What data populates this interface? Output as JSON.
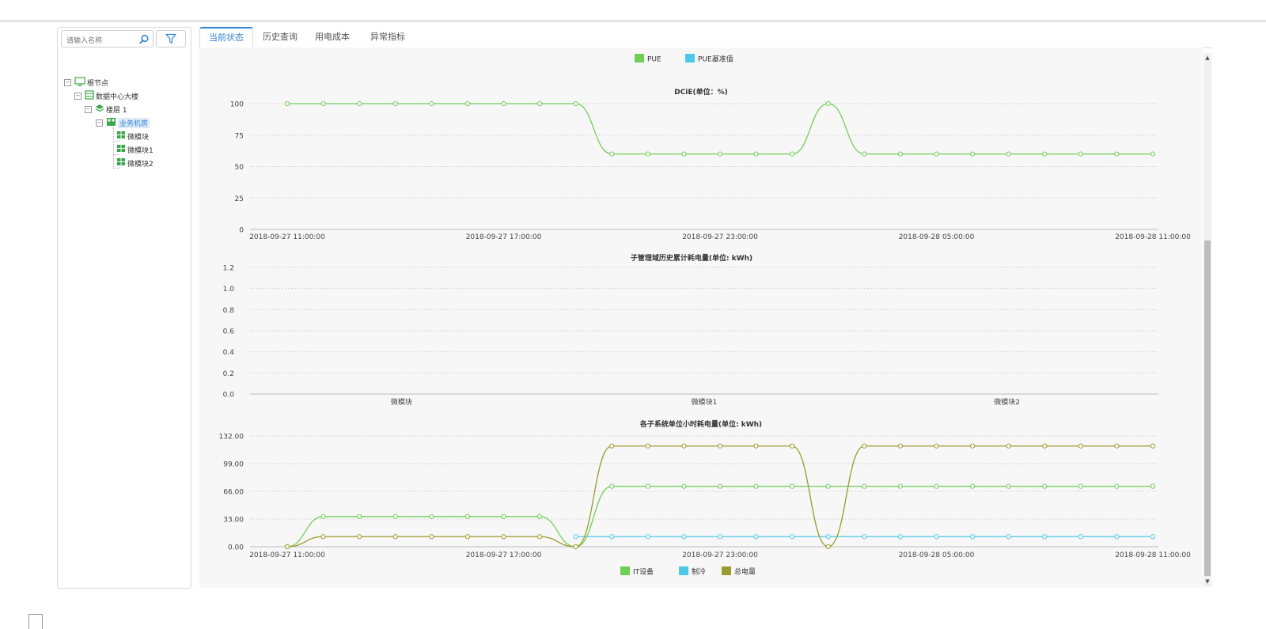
{
  "search": {
    "placeholder": "请输入名称"
  },
  "icons": {
    "search": "search-icon",
    "filter": "filter-icon"
  },
  "tree": {
    "root": "根节点",
    "building": "数据中心大楼",
    "floor": "楼层 1",
    "room": "业务机房",
    "modules": [
      "微模块",
      "微模块1",
      "微模块2"
    ]
  },
  "tabs": [
    "当前状态",
    "历史查询",
    "用电成本",
    "异常指标"
  ],
  "colors": {
    "accent": "#2e87d4",
    "green": "#6fcf57",
    "cyan": "#4dc8ea",
    "olive": "#9a9a2e"
  },
  "chart_data": [
    {
      "type": "line",
      "title": "DCiE(单位：%)",
      "legend": [
        "PUE",
        "PUE基准值"
      ],
      "legend_placement": "top-center",
      "ylim": [
        0,
        100
      ],
      "yticks": [
        "0",
        "25",
        "50",
        "75",
        "100"
      ],
      "x": [
        "2018-09-27 11:00:00",
        "2018-09-27 12:00:00",
        "2018-09-27 13:00:00",
        "2018-09-27 14:00:00",
        "2018-09-27 15:00:00",
        "2018-09-27 16:00:00",
        "2018-09-27 17:00:00",
        "2018-09-27 18:00:00",
        "2018-09-27 19:00:00",
        "2018-09-27 20:00:00",
        "2018-09-27 21:00:00",
        "2018-09-27 22:00:00",
        "2018-09-27 23:00:00",
        "2018-09-28 00:00:00",
        "2018-09-28 01:00:00",
        "2018-09-28 02:00:00",
        "2018-09-28 03:00:00",
        "2018-09-28 04:00:00",
        "2018-09-28 05:00:00",
        "2018-09-28 06:00:00",
        "2018-09-28 07:00:00",
        "2018-09-28 08:00:00",
        "2018-09-28 09:00:00",
        "2018-09-28 10:00:00",
        "2018-09-28 11:00:00"
      ],
      "xticks": [
        "2018-09-27 11:00:00",
        "2018-09-27 17:00:00",
        "2018-09-27 23:00:00",
        "2018-09-28 05:00:00",
        "2018-09-28 11:00:00"
      ],
      "series": [
        {
          "name": "PUE",
          "color": "#6fcf57",
          "values": [
            100,
            100,
            100,
            100,
            100,
            100,
            100,
            100,
            100,
            60,
            60,
            60,
            60,
            60,
            60,
            100,
            60,
            60,
            60,
            60,
            60,
            60,
            60,
            60,
            60
          ]
        }
      ],
      "grid": true
    },
    {
      "type": "bar",
      "title": "子管理域历史累计耗电量(单位: kWh)",
      "categories": [
        "微模块",
        "微模块1",
        "微模块2"
      ],
      "values": [
        0,
        0,
        0
      ],
      "ylim": [
        0,
        1.2
      ],
      "yticks": [
        "0.0",
        "0.2",
        "0.4",
        "0.6",
        "0.8",
        "1.0",
        "1.2"
      ],
      "grid": true
    },
    {
      "type": "line",
      "title": "各子系统单位小时耗电量(单位: kWh)",
      "legend": [
        "IT设备",
        "制冷",
        "总电量"
      ],
      "legend_placement": "bottom-center",
      "ylim": [
        0,
        132
      ],
      "yticks": [
        "0.00",
        "33.00",
        "66.00",
        "99.00",
        "132.00"
      ],
      "xticks": [
        "2018-09-27 11:00:00",
        "2018-09-27 17:00:00",
        "2018-09-27 23:00:00",
        "2018-09-28 05:00:00",
        "2018-09-28 11:00:00"
      ],
      "series": [
        {
          "name": "IT设备",
          "color": "#6fcf57",
          "values": [
            0,
            36,
            36,
            36,
            36,
            36,
            36,
            36,
            0,
            72,
            72,
            72,
            72,
            72,
            72,
            72,
            72,
            72,
            72,
            72,
            72,
            72,
            72,
            72,
            72
          ]
        },
        {
          "name": "制冷",
          "color": "#4dc8ea",
          "values": [
            null,
            null,
            null,
            null,
            null,
            null,
            null,
            null,
            12,
            12,
            12,
            12,
            12,
            12,
            12,
            12,
            12,
            12,
            12,
            12,
            12,
            12,
            12,
            12,
            12
          ]
        },
        {
          "name": "总电量",
          "color": "#9a9a2e",
          "values": [
            0,
            12,
            12,
            12,
            12,
            12,
            12,
            12,
            0,
            120,
            120,
            120,
            120,
            120,
            120,
            0,
            120,
            120,
            120,
            120,
            120,
            120,
            120,
            120,
            120
          ]
        }
      ],
      "grid": true
    }
  ]
}
